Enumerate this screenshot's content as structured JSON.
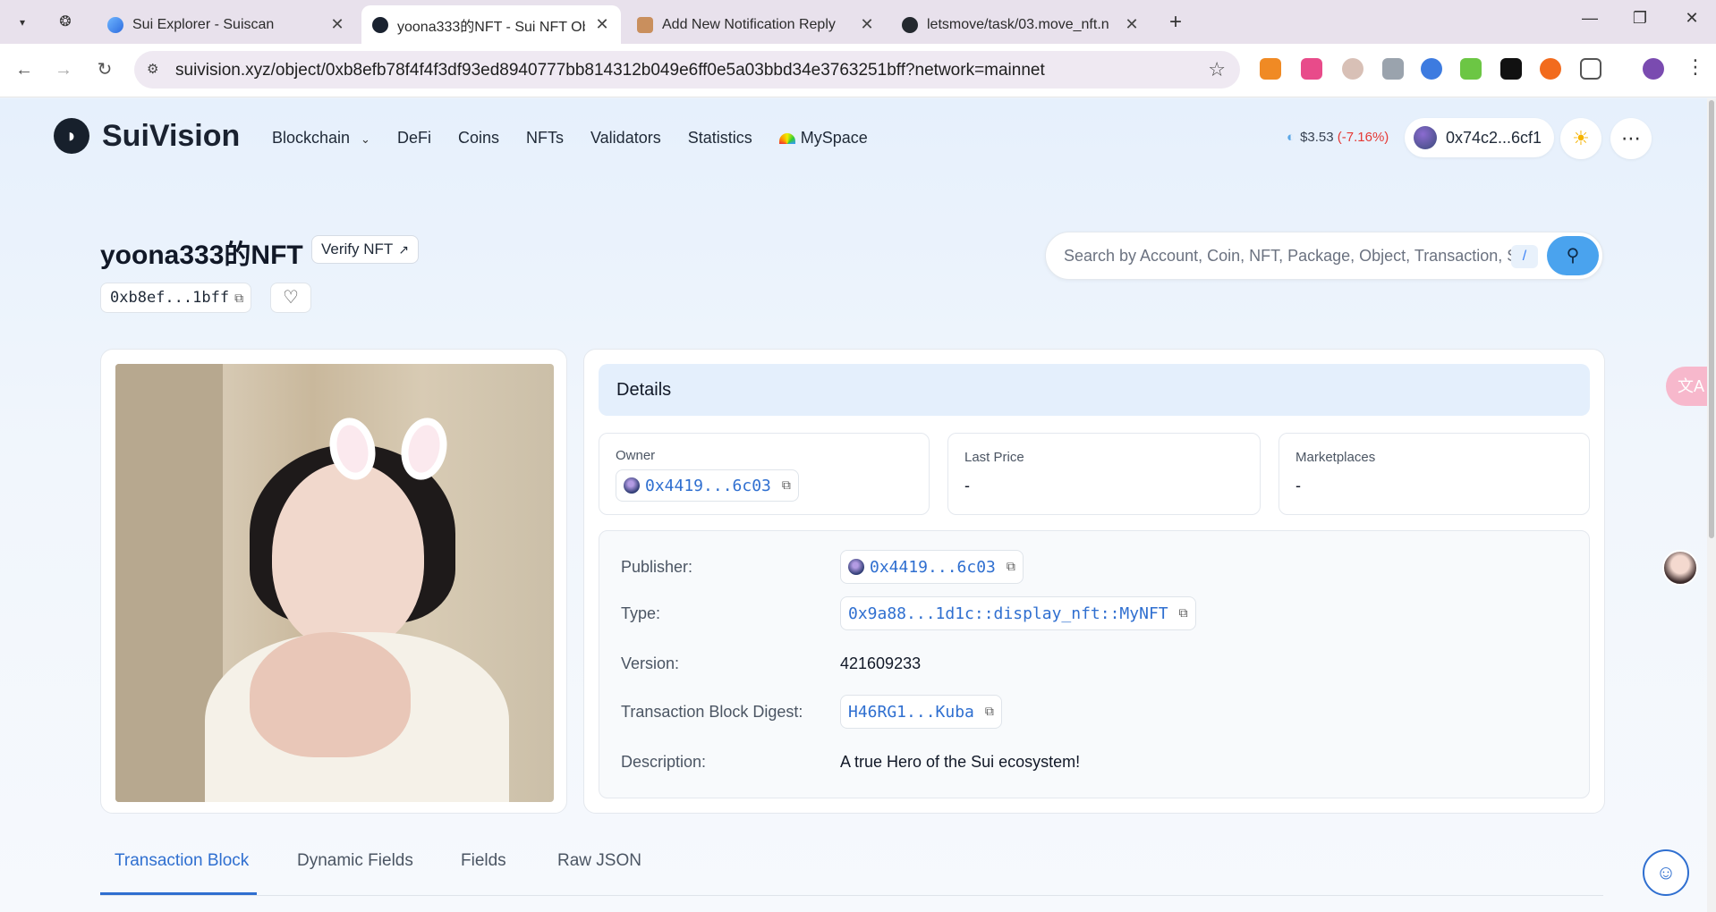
{
  "browser": {
    "tabs": [
      {
        "title": "Sui Explorer - Suiscan"
      },
      {
        "title": "yoona333的NFT - Sui NFT Ob"
      },
      {
        "title": "Add New Notification Reply"
      },
      {
        "title": "letsmove/task/03.move_nft.n"
      }
    ],
    "url": "suivision.xyz/object/0xb8efb78f4f4f3df93ed8940777bb814312b049e6ff0e5a03bbd34e3763251bff?network=mainnet"
  },
  "site": {
    "brand": "SuiVision",
    "nav": [
      "Blockchain",
      "DeFi",
      "Coins",
      "NFTs",
      "Validators",
      "Statistics",
      "MySpace"
    ],
    "price": "$3.53",
    "price_change": "(-7.16%)",
    "wallet": "0x74c2...6cf1"
  },
  "object": {
    "title": "yoona333的NFT",
    "verify_label": "Verify NFT",
    "address_short": "0xb8ef...1bff"
  },
  "search": {
    "placeholder": "Search by Account, Coin, NFT, Package, Object, Transaction, S...",
    "shortcut": "/"
  },
  "details": {
    "header": "Details",
    "owner_label": "Owner",
    "owner_value": "0x4419...6c03",
    "last_price_label": "Last Price",
    "last_price_value": "-",
    "marketplaces_label": "Marketplaces",
    "marketplaces_value": "-",
    "rows": {
      "publisher_label": "Publisher:",
      "publisher_value": "0x4419...6c03",
      "type_label": "Type:",
      "type_value": "0x9a88...1d1c::display_nft::MyNFT",
      "version_label": "Version:",
      "version_value": "421609233",
      "digest_label": "Transaction Block Digest:",
      "digest_value": "H46RG1...Kuba",
      "description_label": "Description:",
      "description_value": "A true Hero of the Sui ecosystem!"
    }
  },
  "tabs": [
    "Transaction Block",
    "Dynamic Fields",
    "Fields",
    "Raw JSON"
  ],
  "colors": {
    "accent": "#2f6fd0",
    "negative": "#e53935",
    "header_bg": "#e4effc"
  }
}
